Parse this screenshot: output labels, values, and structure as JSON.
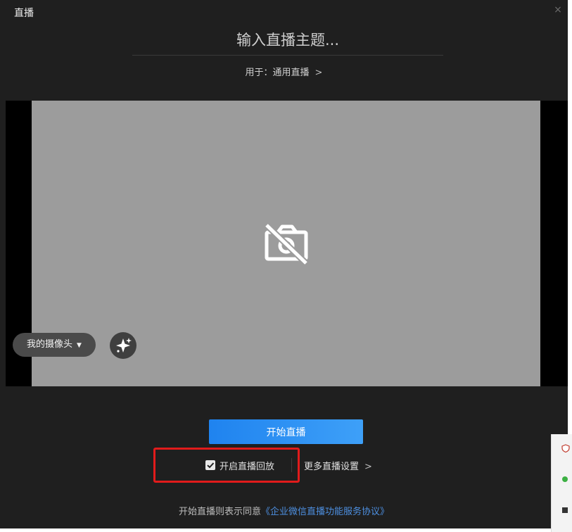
{
  "window": {
    "title": "直播",
    "close_glyph": "×"
  },
  "topic": {
    "placeholder": "输入直播主题..."
  },
  "purpose": {
    "label": "用于：通用直播",
    "chevron": ">"
  },
  "preview": {
    "status_icon": "camera-off-icon"
  },
  "camera": {
    "selected": "我的摄像头",
    "caret": "▼"
  },
  "beauty": {
    "icon": "sparkle-icon"
  },
  "actions": {
    "start_label": "开始直播",
    "replay_label": "开启直播回放",
    "replay_checked": true,
    "more_settings_label": "更多直播设置",
    "more_chevron": ">"
  },
  "agreement": {
    "prefix": "开始直播则表示同意",
    "link": "《企业微信直播功能服务协议》"
  },
  "colors": {
    "window_bg": "#1f1f1f",
    "preview_bg": "#9c9c9c",
    "accent": "#2a8ff2",
    "link": "#4d8fe0",
    "highlight": "#e11b1b"
  },
  "side_panel": {
    "icons": [
      "shield-icon",
      "green-app-icon",
      "dark-app-icon"
    ]
  }
}
